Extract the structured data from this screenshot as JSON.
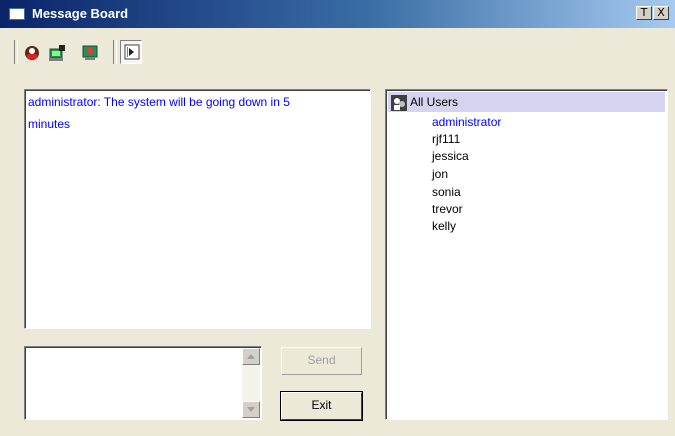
{
  "window": {
    "title": "Message Board",
    "pin_glyph": "T",
    "close_glyph": "X"
  },
  "toolbar": {
    "icons": [
      "broadcast-icon",
      "user-info-icon",
      "screen-icon",
      "exit-board-icon"
    ]
  },
  "messages": [
    {
      "line1": "administrator: The system will be going down in 5",
      "line2": "minutes"
    }
  ],
  "compose": {
    "value": ""
  },
  "buttons": {
    "send": "Send",
    "exit": "Exit"
  },
  "users": {
    "header": "All Users",
    "list": [
      "administrator",
      "rjf111",
      "jessica",
      "jon",
      "sonia",
      "trevor",
      "kelly"
    ],
    "active": "administrator"
  },
  "colors": {
    "accent_text": "#0000ff",
    "selected_header": "#d6d3f0"
  }
}
